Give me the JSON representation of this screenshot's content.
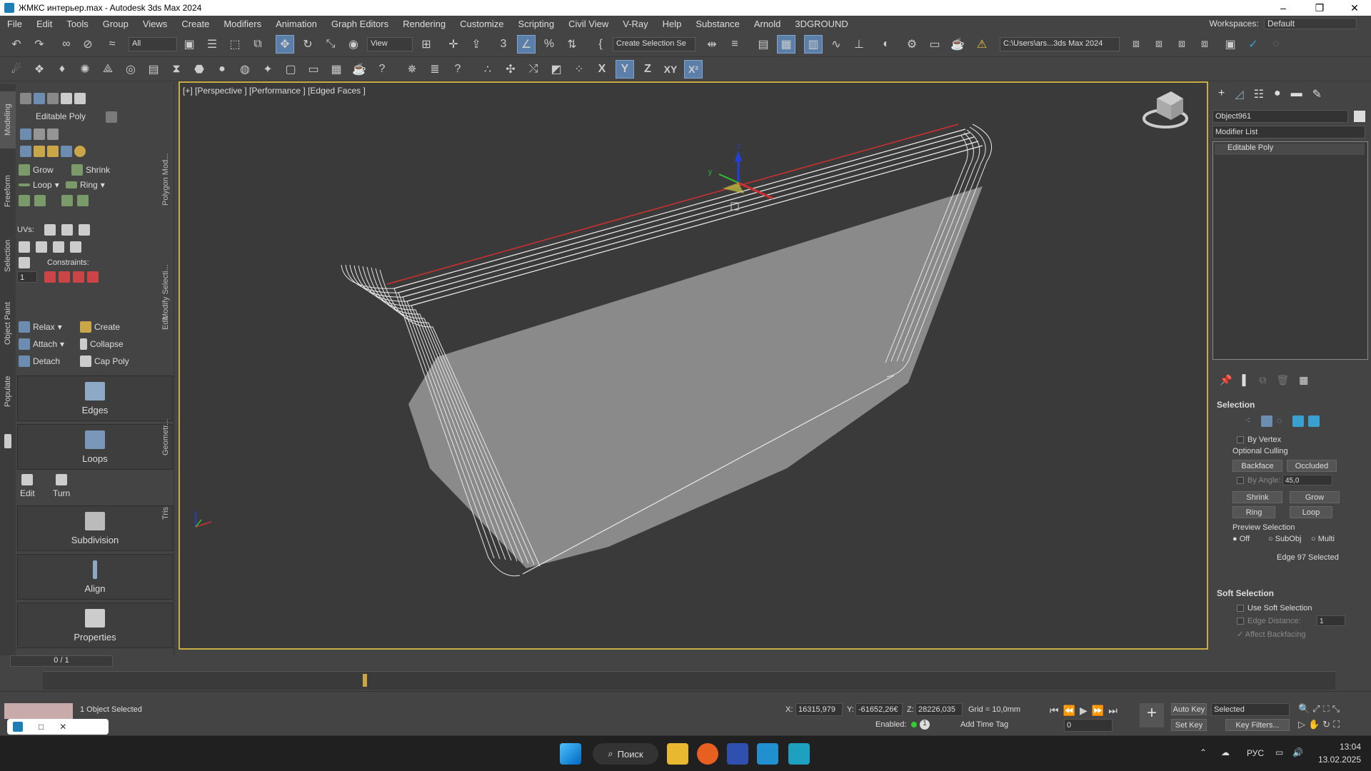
{
  "window": {
    "title": "ЖМКС интерьер.max - Autodesk 3ds Max 2024",
    "minimize": "–",
    "maximize": "❐",
    "close": "✕"
  },
  "menu": [
    "File",
    "Edit",
    "Tools",
    "Group",
    "Views",
    "Create",
    "Modifiers",
    "Animation",
    "Graph Editors",
    "Rendering",
    "Customize",
    "Scripting",
    "Civil View",
    "V-Ray",
    "Help",
    "Substance",
    "Arnold",
    "3DGROUND"
  ],
  "workspaces": {
    "label": "Workspaces:",
    "value": "Default"
  },
  "toolbar1": {
    "filter": "All",
    "view": "View",
    "selset": "Create Selection Se",
    "path": "C:\\Users\\ars...3ds Max 2024"
  },
  "toolbar2": {
    "x": "X",
    "y": "Y",
    "z": "Z",
    "xy": "XY",
    "xz": "X²"
  },
  "lefttabs": [
    "Modeling",
    "Freeform",
    "Selection",
    "Object Paint",
    "Populate"
  ],
  "ribbon": {
    "editable_poly": "Editable Poly",
    "grow": "Grow",
    "shrink": "Shrink",
    "loop": "Loop",
    "ring": "Ring",
    "uvs": "UVs:",
    "constraints": "Constraints:",
    "spin": "1",
    "relax": "Relax",
    "create": "Create",
    "attach": "Attach",
    "collapse": "Collapse",
    "detach": "Detach",
    "cap_poly": "Cap Poly",
    "edges": "Edges",
    "loops": "Loops",
    "edit": "Edit",
    "turn": "Turn",
    "subdivision": "Subdivision",
    "align": "Align",
    "properties": "Properties",
    "side": [
      "Polygon Mod...",
      "Modify Selecti...",
      "Edit",
      "Geometr...",
      "Tris"
    ],
    "pager": "0 / 1"
  },
  "viewport": {
    "label": "[+] [Perspective ] [Performance ] [Edged Faces ]",
    "axis_z": "z",
    "axis_y": "y"
  },
  "rightpanel": {
    "object_name": "Object961",
    "modifier_list": "Modifier List",
    "stack_item": "Editable Poly",
    "selection_title": "Selection",
    "by_vertex": "By Vertex",
    "optional_culling": "Optional Culling",
    "backface": "Backface",
    "occluded": "Occluded",
    "by_angle": "By Angle:",
    "angle_value": "45,0",
    "shrink": "Shrink",
    "grow": "Grow",
    "ring": "Ring",
    "loop": "Loop",
    "preview_selection": "Preview Selection",
    "off": "Off",
    "subobj": "SubObj",
    "multi": "Multi",
    "edge_selected": "Edge 97 Selected",
    "soft_title": "Soft Selection",
    "use_soft": "Use Soft Selection",
    "edge_distance": "Edge Distance:",
    "edge_distance_val": "1",
    "affect_backfacing": "Affect Backfacing"
  },
  "status": {
    "objects_selected": "1 Object Selected",
    "x_label": "X:",
    "x": "16315,979",
    "y_label": "Y:",
    "y": "-61652,26€",
    "z_label": "Z:",
    "z": "28226,035",
    "grid": "Grid = 10,0mm",
    "enabled": "Enabled:",
    "add_time_tag": "Add Time Tag",
    "autokey": "Auto Key",
    "setkey": "Set Key",
    "selected": "Selected",
    "key_filters": "Key Filters...",
    "frame": "0",
    "one": "1"
  },
  "taskbar": {
    "search": "Поиск",
    "lang": "РУС",
    "time": "13:04",
    "date": "13.02.2025"
  }
}
